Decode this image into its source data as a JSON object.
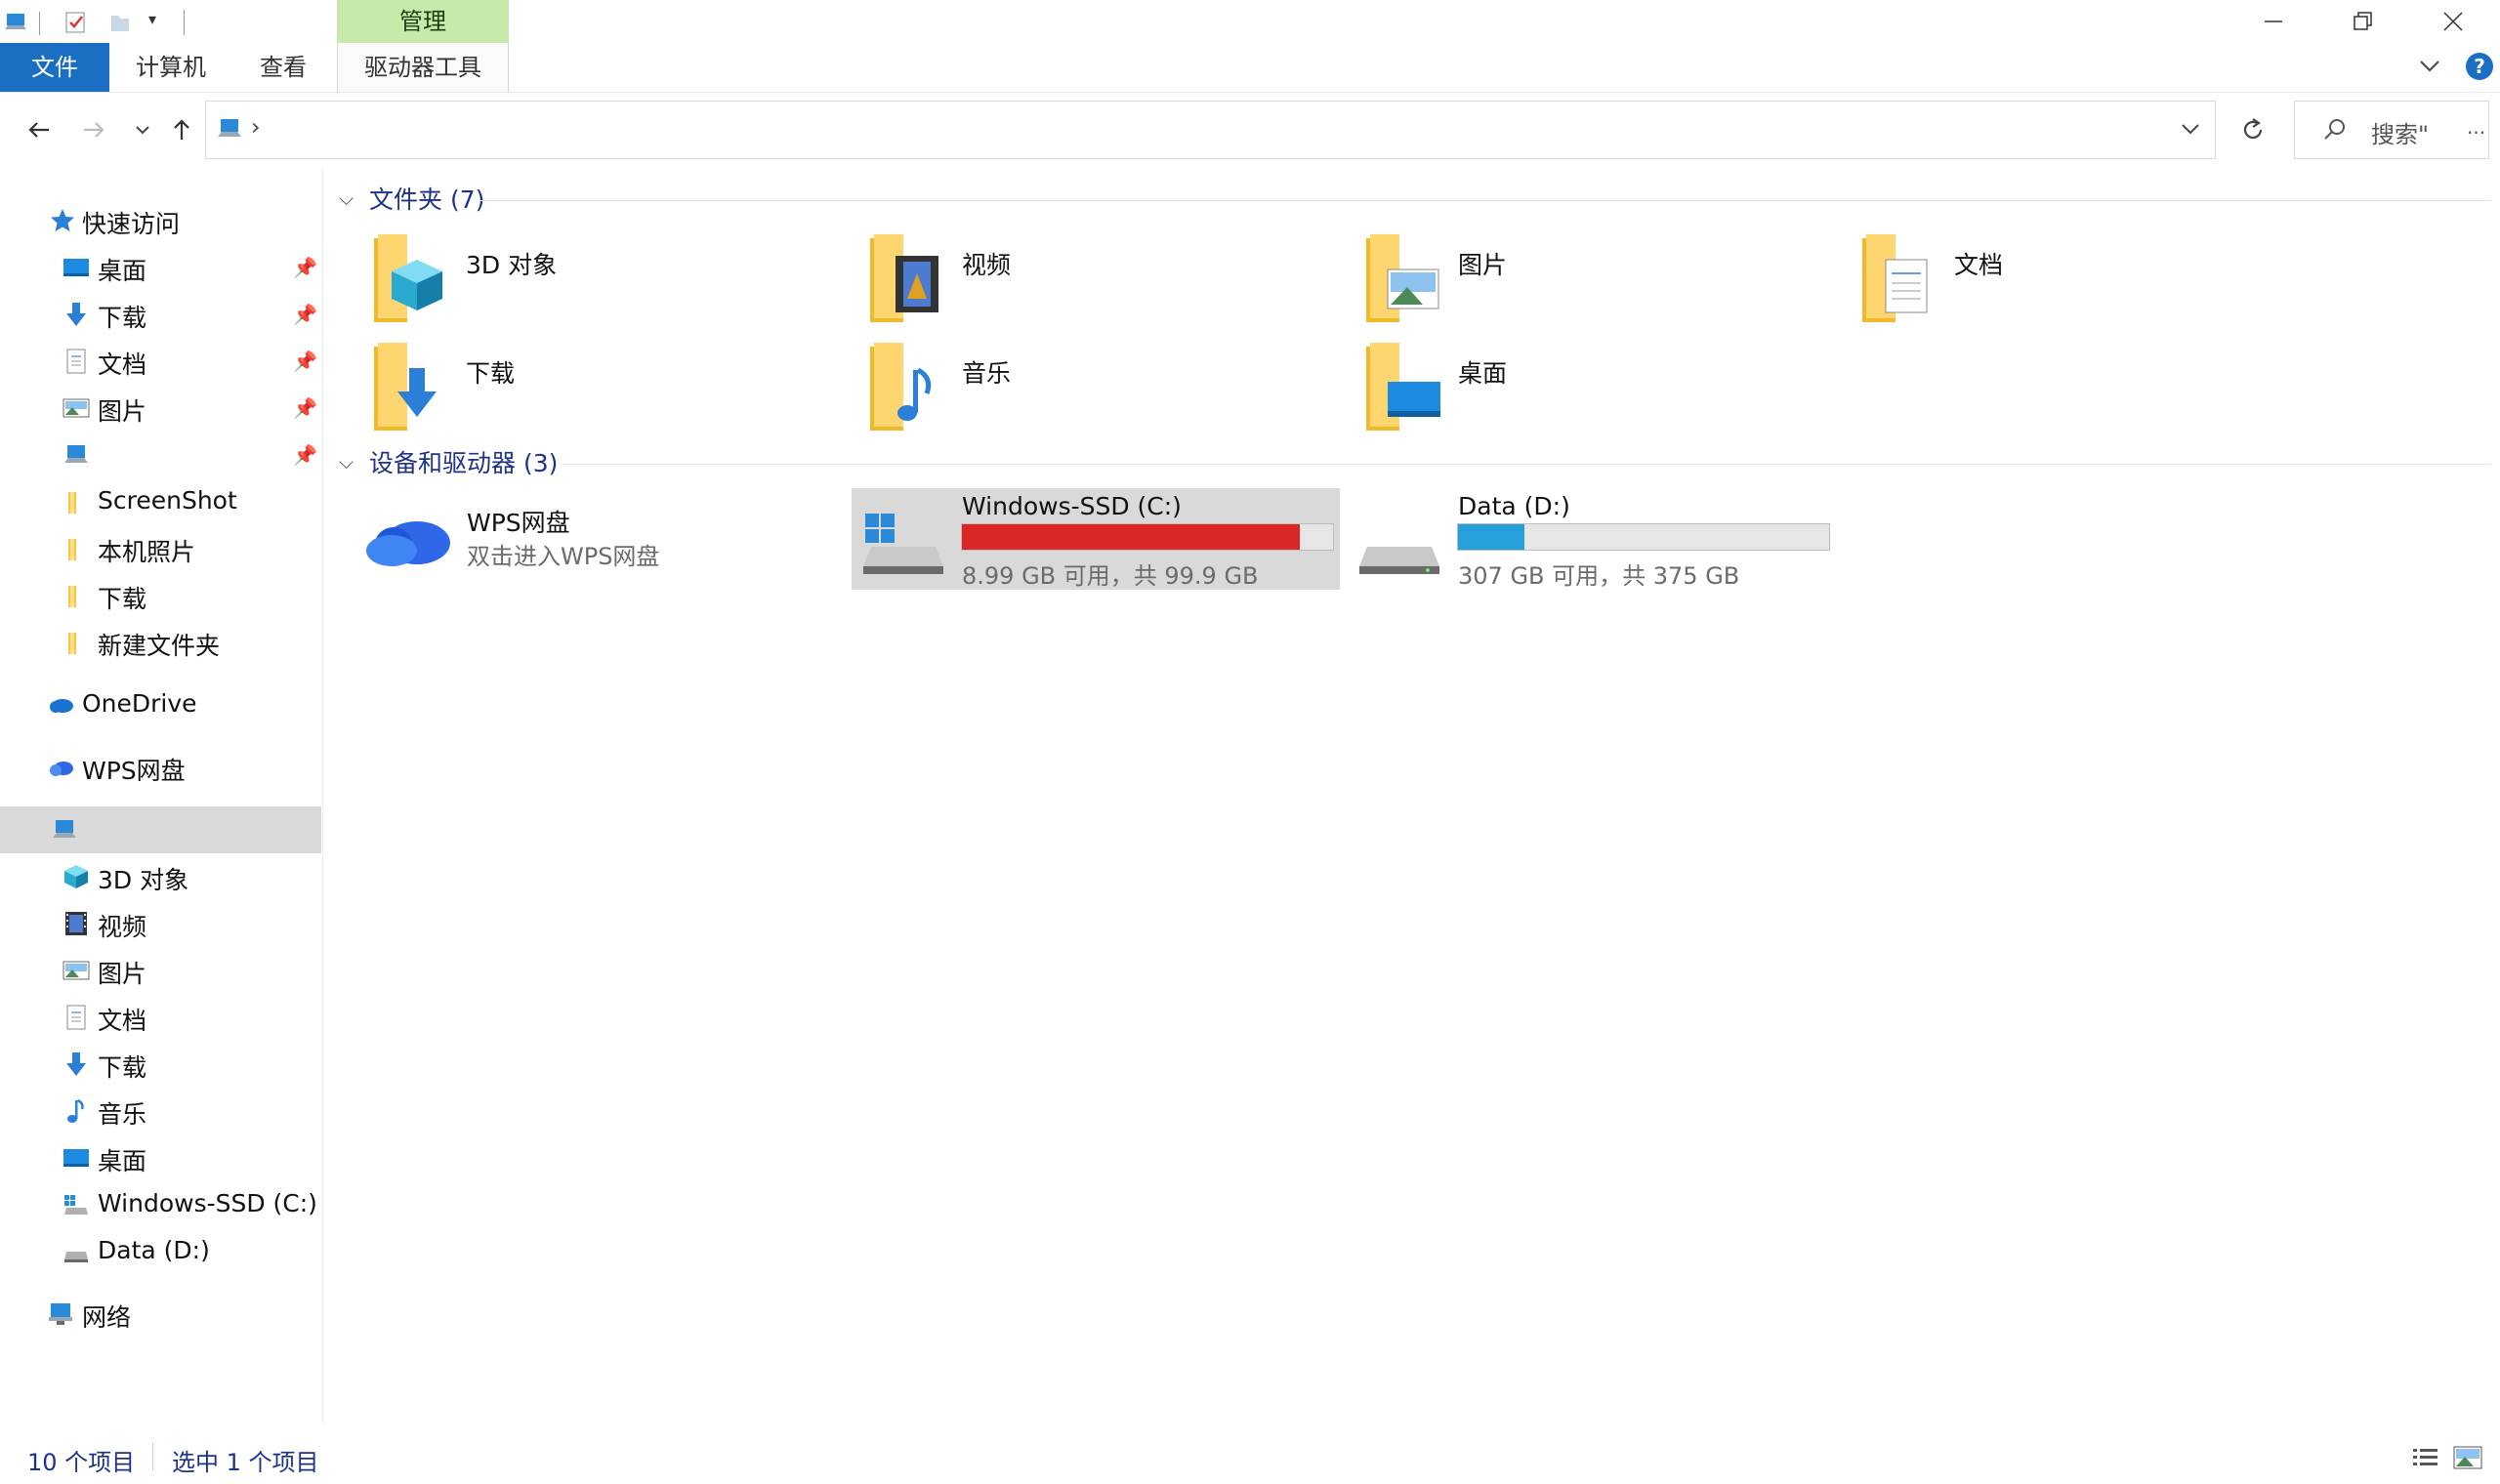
{
  "ribbon": {
    "context_header": "管理",
    "tabs": [
      "文件",
      "计算机",
      "查看",
      "驱动器工具"
    ]
  },
  "window": {
    "minimize_icon": "minimize-icon",
    "restore_icon": "restore-icon",
    "close_icon": "close-icon",
    "help_label": "?"
  },
  "navigation": {
    "back_icon": "back-arrow-icon",
    "forward_icon": "forward-arrow-icon",
    "recent_icon": "chevron-down-icon",
    "up_icon": "up-arrow-icon",
    "address_separator": "›",
    "refresh_icon": "refresh-icon",
    "search_placeholder": "搜索\"",
    "search_more": "..."
  },
  "sidebar": {
    "quick_access": "快速访问",
    "quick_items": [
      "桌面",
      "下载",
      "文档",
      "图片",
      "",
      "ScreenShot",
      "本机照片",
      "下载",
      "新建文件夹"
    ],
    "onedrive": "OneDrive",
    "wps": "WPS网盘",
    "this_pc": "",
    "pc_items": [
      "3D 对象",
      "视频",
      "图片",
      "文档",
      "下载",
      "音乐",
      "桌面",
      "Windows-SSD (C:)",
      "Data (D:)"
    ],
    "network": "网络"
  },
  "content": {
    "folders_header": "文件夹 (7)",
    "folders": [
      "3D 对象",
      "视频",
      "图片",
      "文档",
      "下载",
      "音乐",
      "桌面"
    ],
    "devices_header": "设备和驱动器 (3)",
    "wps": {
      "name": "WPS网盘",
      "subtitle": "双击进入WPS网盘"
    },
    "drives": [
      {
        "name": "Windows-SSD (C:)",
        "free_text": "8.99 GB 可用，共 99.9 GB",
        "used_fraction": 0.91,
        "bar_color": "#da2626"
      },
      {
        "name": "Data (D:)",
        "free_text": "307 GB 可用，共 375 GB",
        "used_fraction": 0.18,
        "bar_color": "#26a0da"
      }
    ]
  },
  "status": {
    "item_count": "10 个项目",
    "selected": "选中 1 个项目"
  }
}
